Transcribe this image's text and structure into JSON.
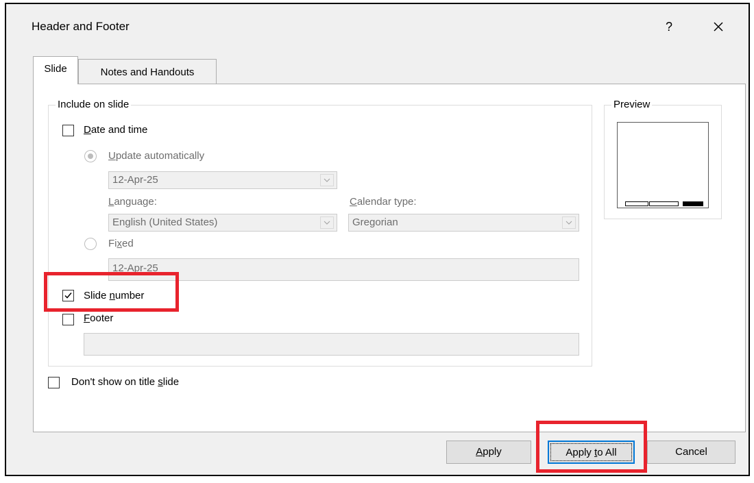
{
  "dialog": {
    "title": "Header and Footer",
    "help_label": "?",
    "close_icon": "close-icon"
  },
  "tabs": [
    {
      "label": "Slide",
      "active": true
    },
    {
      "label": "Notes and Handouts",
      "active": false
    }
  ],
  "include_group": {
    "legend": "Include on slide",
    "date_time": {
      "label_mnemonic": "D",
      "label_rest": "ate and time",
      "checked": false
    },
    "update_auto": {
      "label_mnemonic": "U",
      "label_rest": "pdate automatically",
      "selected": true,
      "disabled": true
    },
    "date_format": {
      "value": "12-Apr-25",
      "disabled": true
    },
    "language": {
      "label_mnemonic": "L",
      "label_rest": "anguage:",
      "value": "English (United States)",
      "disabled": true
    },
    "calendar": {
      "label_mnemonic": "C",
      "label_rest": "alendar type:",
      "value": "Gregorian",
      "disabled": true
    },
    "fixed": {
      "label_pre": "Fi",
      "label_mnemonic": "x",
      "label_post": "ed",
      "selected": false,
      "disabled": true
    },
    "fixed_value": {
      "value": "12-Apr-25",
      "disabled": true
    },
    "slide_number": {
      "label_pre": "Slide ",
      "label_mnemonic": "n",
      "label_post": "umber",
      "checked": true
    },
    "footer": {
      "label_mnemonic": "F",
      "label_rest": "ooter",
      "checked": false,
      "value": ""
    }
  },
  "dont_show_title": {
    "label_pre": "Don't show on title ",
    "label_mnemonic": "s",
    "label_post": "lide",
    "checked": false
  },
  "preview": {
    "legend": "Preview",
    "placeholders": [
      "date",
      "footer",
      "slide-number"
    ],
    "active_placeholder": "slide-number"
  },
  "buttons": {
    "apply_mnemonic": "A",
    "apply_rest": "pply",
    "apply_all_pre": "Apply ",
    "apply_all_mnemonic": "t",
    "apply_all_post": "o All",
    "cancel": "Cancel"
  },
  "colors": {
    "highlight": "#e8232d",
    "default_button_border": "#0078d7",
    "disabled_text": "#6d6d6d"
  }
}
